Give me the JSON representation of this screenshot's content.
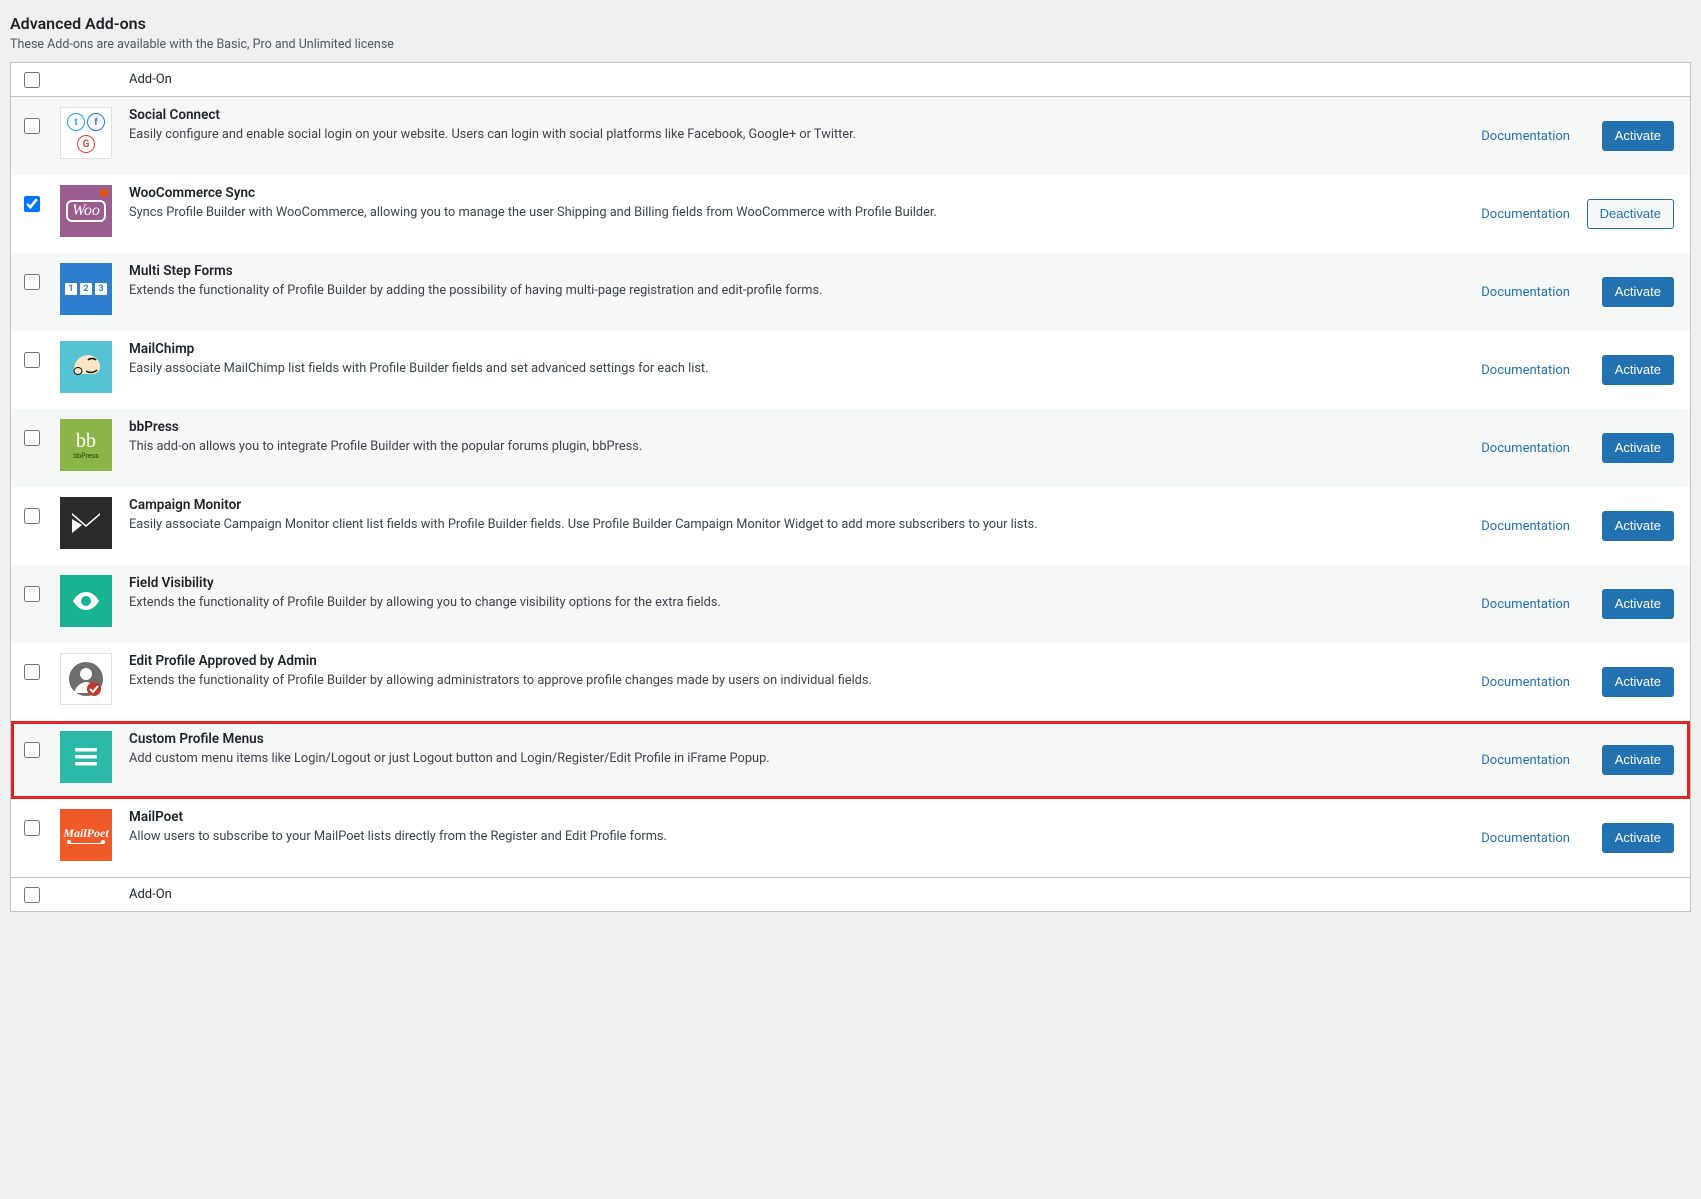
{
  "header": {
    "title": "Advanced Add-ons",
    "subtitle": "These Add-ons are available with the Basic, Pro and Unlimited license"
  },
  "table_header": "Add-On",
  "labels": {
    "documentation": "Documentation",
    "activate": "Activate",
    "deactivate": "Deactivate"
  },
  "addons": [
    {
      "id": "social-connect",
      "name": "Social Connect",
      "desc": "Easily configure and enable social login on your website. Users can login with social platforms like Facebook, Google+ or Twitter.",
      "checked": false,
      "active": false,
      "highlight": false
    },
    {
      "id": "woocommerce-sync",
      "name": "WooCommerce Sync",
      "desc": "Syncs Profile Builder with WooCommerce, allowing you to manage the user Shipping and Billing fields from WooCommerce with Profile Builder.",
      "checked": true,
      "active": true,
      "highlight": false
    },
    {
      "id": "multi-step-forms",
      "name": "Multi Step Forms",
      "desc": "Extends the functionality of Profile Builder by adding the possibility of having multi-page registration and edit-profile forms.",
      "checked": false,
      "active": false,
      "highlight": false
    },
    {
      "id": "mailchimp",
      "name": "MailChimp",
      "desc": "Easily associate MailChimp list fields with Profile Builder fields and set advanced settings for each list.",
      "checked": false,
      "active": false,
      "highlight": false
    },
    {
      "id": "bbpress",
      "name": "bbPress",
      "desc": "This add-on allows you to integrate Profile Builder with the popular forums plugin, bbPress.",
      "checked": false,
      "active": false,
      "highlight": false
    },
    {
      "id": "campaign-monitor",
      "name": "Campaign Monitor",
      "desc": "Easily associate Campaign Monitor client list fields with Profile Builder fields. Use Profile Builder Campaign Monitor Widget to add more subscribers to your lists.",
      "checked": false,
      "active": false,
      "highlight": false
    },
    {
      "id": "field-visibility",
      "name": "Field Visibility",
      "desc": "Extends the functionality of Profile Builder by allowing you to change visibility options for the extra fields.",
      "checked": false,
      "active": false,
      "highlight": false
    },
    {
      "id": "edit-profile-approved",
      "name": "Edit Profile Approved by Admin",
      "desc": "Extends the functionality of Profile Builder by allowing administrators to approve profile changes made by users on individual fields.",
      "checked": false,
      "active": false,
      "highlight": false
    },
    {
      "id": "custom-profile-menus",
      "name": "Custom Profile Menus",
      "desc": "Add custom menu items like Login/Logout or just Logout button and Login/Register/Edit Profile in iFrame Popup.",
      "checked": false,
      "active": false,
      "highlight": true
    },
    {
      "id": "mailpoet",
      "name": "MailPoet",
      "desc": "Allow users to subscribe to your MailPoet lists directly from the Register and Edit Profile forms.",
      "checked": false,
      "active": false,
      "highlight": false
    }
  ]
}
